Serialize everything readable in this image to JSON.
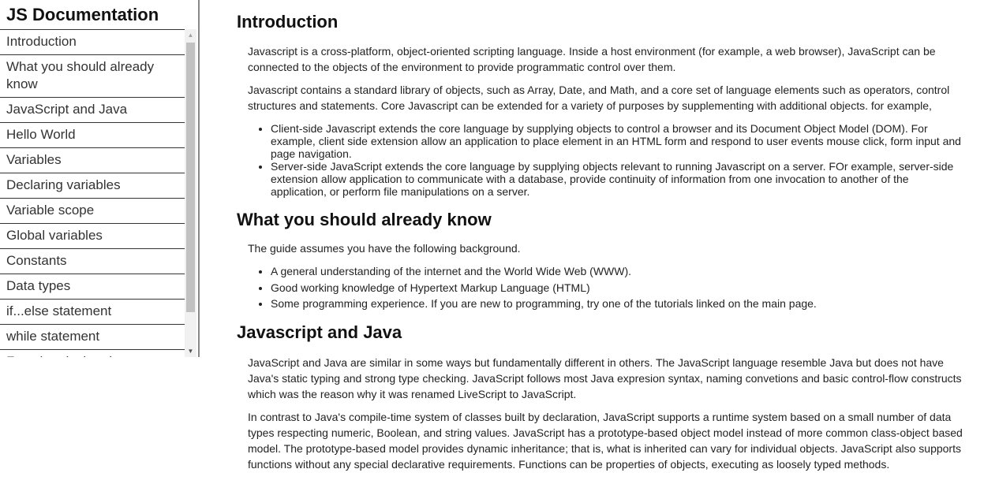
{
  "sidebar": {
    "title": "JS Documentation",
    "items": [
      "Introduction",
      "What you should already know",
      "JavaScript and Java",
      "Hello World",
      "Variables",
      "Declaring variables",
      "Variable scope",
      "Global variables",
      "Constants",
      "Data types",
      "if...else statement",
      "while statement",
      "Function declarations"
    ]
  },
  "sections": {
    "introduction": {
      "heading": "Introduction",
      "p1": "Javascript is a cross-platform, object-oriented scripting language. Inside a host environment (for example, a web browser), JavaScript can be connected to the objects of the environment to provide programmatic control over them.",
      "p2": "Javascript contains a standard library of objects, such as Array, Date, and Math, and a core set of language elements such as operators, control structures and statements. Core Javascript can be extended for a variety of purposes by supplementing with additional objects. for example,",
      "bullets": [
        "Client-side Javascript extends the core language by supplying objects to control a browser and its Document Object Model (DOM). For example, client side extension allow an application to place element in an HTML form and respond to user events mouse click, form input and page navigation.",
        "Server-side JavaScript extends the core language by supplying objects relevant to running Javascript on a server. FOr example, server-side extension allow application to communicate with a database, provide continuity of information from one invocation to another of the application, or perform file manipulations on a server."
      ]
    },
    "already_know": {
      "heading": "What you should already know",
      "p1": "The guide assumes you have the following background.",
      "bullets": [
        "A general understanding of the internet and the World Wide Web (WWW).",
        "Good working knowledge of Hypertext Markup Language (HTML)",
        "Some programming experience. If you are new to programming, try one of the tutorials linked on the main page."
      ]
    },
    "js_and_java": {
      "heading": "Javascript and Java",
      "p1": "JavaScript and Java are similar in some ways but fundamentally different in others. The JavaScript language resemble Java but does not have Java's static typing and strong type checking. JavaScript follows most Java expresion syntax, naming convetions and basic control-flow constructs which was the reason why it was renamed LiveScript to JavaScript.",
      "p2": "In contrast to Java's compile-time system of classes built by declaration, JavaScript supports a runtime system based on a small number of data types respecting numeric, Boolean, and string values. JavaScript has a prototype-based object model instead of more common class-object based model. The prototype-based model provides dynamic inheritance; that is, what is inherited can vary for individual objects. JavaScript also supports functions without any special declarative requirements. Functions can be properties of objects, executing as loosely typed methods."
    }
  },
  "icons": {
    "scroll_up": "arrow-up-icon",
    "scroll_down": "arrow-down-icon"
  }
}
